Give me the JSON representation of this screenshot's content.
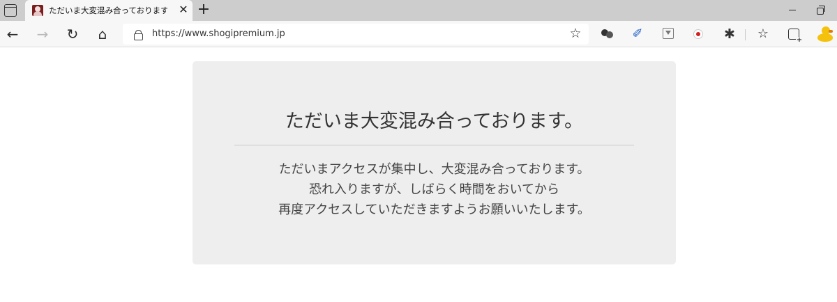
{
  "browser": {
    "tab": {
      "title": "ただいま大変混み合っております。",
      "close_glyph": "✕"
    },
    "new_tab_glyph": "+",
    "toolbar": {
      "back_glyph": "←",
      "forward_glyph": "→",
      "refresh_glyph": "↻",
      "home_glyph": "⌂",
      "url": "https://www.shogipremium.jp",
      "favorite_glyph": "☆",
      "extension_feather_glyph": "✐",
      "extensions_glyph": "✱",
      "favorites_glyph": "☆"
    },
    "icons": [
      "tab-actions-icon",
      "favicon",
      "close-icon",
      "plus-icon",
      "back-arrow-icon",
      "forward-arrow-icon",
      "refresh-icon",
      "home-icon",
      "lock-icon",
      "add-favorite-star-icon",
      "extension-dots-icon",
      "extension-feather-icon",
      "extension-download-icon",
      "extension-record-icon",
      "extensions-puzzle-icon",
      "favorites-icon",
      "collections-icon",
      "profile-duck-icon"
    ],
    "colors": {
      "tabstrip": "#cdcdcd",
      "toolbar": "#f7f7f7",
      "feather_icon": "#1f5fc4",
      "record_dot": "#d21f1f",
      "profile_duck": "#f4c20d"
    }
  },
  "page": {
    "title": "ただいま大変混み合っております。",
    "message_lines": [
      "ただいまアクセスが集中し、大変混み合っております。",
      "恐れ入りますが、しばらく時間をおいてから",
      "再度アクセスしていただきますようお願いいたします。"
    ],
    "colors": {
      "panel_background": "#eeeeee",
      "title_text": "#333333",
      "body_text": "#444444"
    }
  }
}
